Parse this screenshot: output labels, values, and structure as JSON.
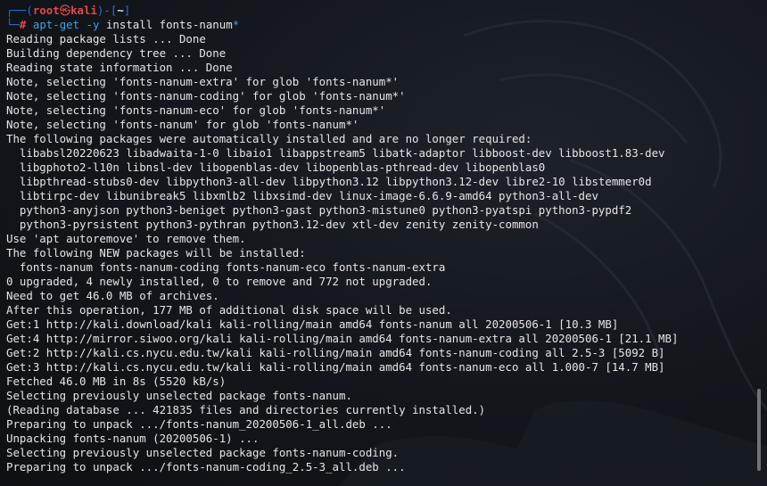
{
  "prompt": {
    "corner": "┌──(",
    "user": "root",
    "skull": "㉿",
    "host": "kali",
    "close_open": ")-[",
    "dir": "~",
    "close": "]",
    "line2_corner": "└─",
    "hash": "#"
  },
  "command": {
    "name": "apt-get",
    "flag": "-y",
    "args": "install fonts-nanum",
    "glob": "*"
  },
  "output": [
    "Reading package lists ... Done",
    "Building dependency tree ... Done",
    "Reading state information ... Done",
    "Note, selecting 'fonts-nanum-extra' for glob 'fonts-nanum*'",
    "Note, selecting 'fonts-nanum-coding' for glob 'fonts-nanum*'",
    "Note, selecting 'fonts-nanum-eco' for glob 'fonts-nanum*'",
    "Note, selecting 'fonts-nanum' for glob 'fonts-nanum*'",
    "The following packages were automatically installed and are no longer required:",
    "  libabsl20220623 libadwaita-1-0 libaio1 libappstream5 libatk-adaptor libboost-dev libboost1.83-dev",
    "  libgphoto2-l10n libnsl-dev libopenblas-dev libopenblas-pthread-dev libopenblas0",
    "  libpthread-stubs0-dev libpython3-all-dev libpython3.12 libpython3.12-dev libre2-10 libstemmer0d",
    "  libtirpc-dev libunibreak5 libxmlb2 libxsimd-dev linux-image-6.6.9-amd64 python3-all-dev",
    "  python3-anyjson python3-beniget python3-gast python3-mistune0 python3-pyatspi python3-pypdf2",
    "  python3-pyrsistent python3-pythran python3.12-dev xtl-dev zenity zenity-common",
    "Use 'apt autoremove' to remove them.",
    "The following NEW packages will be installed:",
    "  fonts-nanum fonts-nanum-coding fonts-nanum-eco fonts-nanum-extra",
    "0 upgraded, 4 newly installed, 0 to remove and 772 not upgraded.",
    "Need to get 46.0 MB of archives.",
    "After this operation, 177 MB of additional disk space will be used.",
    "Get:1 http://kali.download/kali kali-rolling/main amd64 fonts-nanum all 20200506-1 [10.3 MB]",
    "Get:4 http://mirror.siwoo.org/kali kali-rolling/main amd64 fonts-nanum-extra all 20200506-1 [21.1 MB]",
    "Get:2 http://kali.cs.nycu.edu.tw/kali kali-rolling/main amd64 fonts-nanum-coding all 2.5-3 [5092 B]",
    "Get:3 http://kali.cs.nycu.edu.tw/kali kali-rolling/main amd64 fonts-nanum-eco all 1.000-7 [14.7 MB]",
    "Fetched 46.0 MB in 8s (5520 kB/s)",
    "Selecting previously unselected package fonts-nanum.",
    "(Reading database ... 421835 files and directories currently installed.)",
    "Preparing to unpack .../fonts-nanum_20200506-1_all.deb ...",
    "Unpacking fonts-nanum (20200506-1) ...",
    "Selecting previously unselected package fonts-nanum-coding.",
    "Preparing to unpack .../fonts-nanum-coding_2.5-3_all.deb ..."
  ],
  "colors": {
    "background": "#14181e",
    "text": "#e6e6e6",
    "prompt_blue": "#2b6fd6",
    "prompt_red": "#e04a4a",
    "command_blue": "#3ea0e6"
  }
}
